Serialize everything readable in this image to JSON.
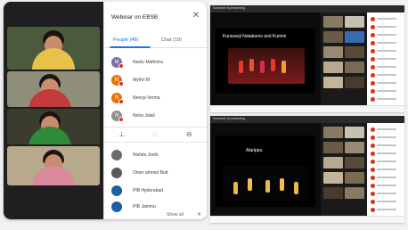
{
  "meet": {
    "panel_title": "Webinar on EBSB",
    "tabs": {
      "people": "People (48)",
      "chat": "Chat (19)"
    },
    "people": [
      {
        "initial": "M",
        "name": "Neelu Malhotra",
        "color": "#7a6fa8"
      },
      {
        "initial": "M",
        "name": "Mythri M",
        "color": "#e8710a"
      },
      {
        "initial": "N",
        "name": "Neerja Verma",
        "color": "#e8710a"
      },
      {
        "initial": "N",
        "name": "Neha Jalali",
        "color": "#8e8e8e"
      },
      {
        "initial": "",
        "name": "Nishita Joshi",
        "color": "#6b6b6b"
      },
      {
        "initial": "",
        "name": "Omer ahmed Butt",
        "color": "#5a5a5a"
      },
      {
        "initial": "",
        "name": "PIB Hyderabad",
        "color": "#1a5fa8"
      },
      {
        "initial": "",
        "name": "PIB Jammu",
        "color": "#1a5fa8"
      }
    ],
    "show_all": "Show all",
    "icons": [
      "pin-icon",
      "mute-icon",
      "remove-icon",
      "close-icon"
    ]
  },
  "shots": [
    {
      "presenting": "Someone is presenting",
      "slide_title": "Kuravanji Natakams and Kummi"
    },
    {
      "presenting": "Someone is presenting",
      "slide_title": "Alarippu"
    }
  ]
}
